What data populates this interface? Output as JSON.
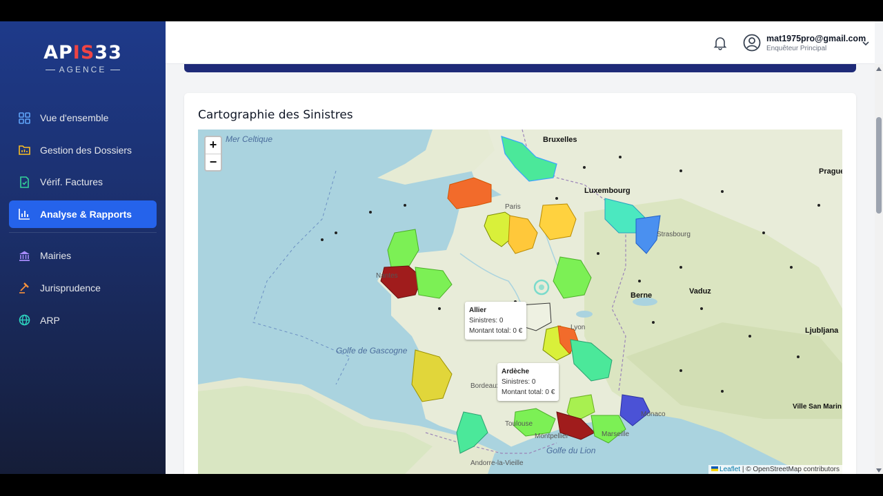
{
  "app": {
    "logo_prefix": "AP",
    "logo_accent": "IS",
    "logo_suffix": "33",
    "logo_sub": "AGENCE"
  },
  "sidebar": {
    "items": [
      {
        "label": "Vue d'ensemble",
        "icon": "grid-icon",
        "active": false
      },
      {
        "label": "Gestion des Dossiers",
        "icon": "folder-chart-icon",
        "active": false
      },
      {
        "label": "Vérif. Factures",
        "icon": "file-check-icon",
        "active": false
      },
      {
        "label": "Analyse & Rapports",
        "icon": "bar-chart-icon",
        "active": true
      },
      {
        "label": "Mairies",
        "icon": "bank-icon",
        "active": false
      },
      {
        "label": "Jurisprudence",
        "icon": "gavel-icon",
        "active": false
      },
      {
        "label": "ARP",
        "icon": "globe-icon",
        "active": false
      }
    ]
  },
  "header": {
    "user_email": "mat1975pro@gmail.com",
    "user_role": "Enquêteur Principal"
  },
  "card": {
    "title": "Cartographie des Sinistres"
  },
  "map": {
    "zoom_in": "+",
    "zoom_out": "−",
    "tooltips": [
      {
        "name": "Allier",
        "sinistres": "Sinistres: 0",
        "montant": "Montant total: 0 €"
      },
      {
        "name": "Ardèche",
        "sinistres": "Sinistres: 0",
        "montant": "Montant total: 0 €"
      }
    ],
    "attribution_leaflet": "Leaflet",
    "attribution_rest": " | © OpenStreetMap contributors",
    "labels": {
      "celtique": "Mer Celtique",
      "gascogne": "Golfe de Gascogne",
      "lion": "Golfe du Lion",
      "bruxelles": "Bruxelles",
      "luxembourg": "Luxembourg",
      "prague": "Prague",
      "berne": "Berne",
      "vaduz": "Vaduz",
      "ljubljana": "Ljubljana",
      "sanmarin": "Ville San Marin",
      "bordeaux": "Bordeaux",
      "toulouse": "Toulouse",
      "nantes": "Nantes",
      "lyon": "Lyon",
      "paris": "Paris",
      "strasbourg": "Strasbourg",
      "marseille": "Marseille",
      "montpellier": "Montpellier",
      "andorre": "Andorre-la-Vieille",
      "monaco": "Monaco"
    }
  },
  "colors": {
    "sidebar_active": "#2563eb",
    "header_strip": "#1e2a78",
    "dept_green": "#7cf055",
    "dept_yellow": "#ffd23f",
    "dept_orange": "#f26b2b",
    "dept_red": "#a01c1c",
    "dept_teal": "#4be89a",
    "dept_blue": "#4a90f0",
    "dept_purple": "#4b52d6"
  }
}
